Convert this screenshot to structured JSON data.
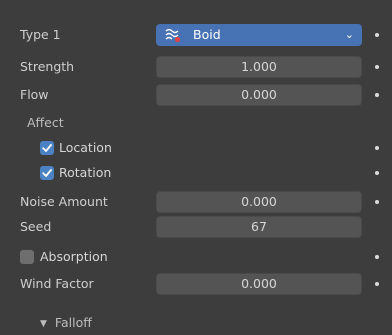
{
  "type1": {
    "label": "Type 1",
    "value": "Boid"
  },
  "strength": {
    "label": "Strength",
    "value": "1.000"
  },
  "flow": {
    "label": "Flow",
    "value": "0.000"
  },
  "affect": {
    "label": "Affect",
    "location": {
      "label": "Location",
      "checked": true
    },
    "rotation": {
      "label": "Rotation",
      "checked": true
    }
  },
  "noise_amount": {
    "label": "Noise Amount",
    "value": "0.000"
  },
  "seed": {
    "label": "Seed",
    "value": "67"
  },
  "absorption": {
    "label": "Absorption",
    "checked": false
  },
  "wind_factor": {
    "label": "Wind Factor",
    "value": "0.000"
  },
  "falloff": {
    "label": "Falloff",
    "expanded": false
  },
  "colors": {
    "accent": "#4772b3",
    "checkbox_on": "#4a82c4",
    "field_bg": "#545454",
    "panel_bg": "#3d3d3d"
  },
  "icons": {
    "type_icon": "boid-icon",
    "dropdown": "chevron-down-icon",
    "keyframe": "keyframe-dot-icon",
    "panel_toggle": "disclosure-triangle-icon"
  }
}
